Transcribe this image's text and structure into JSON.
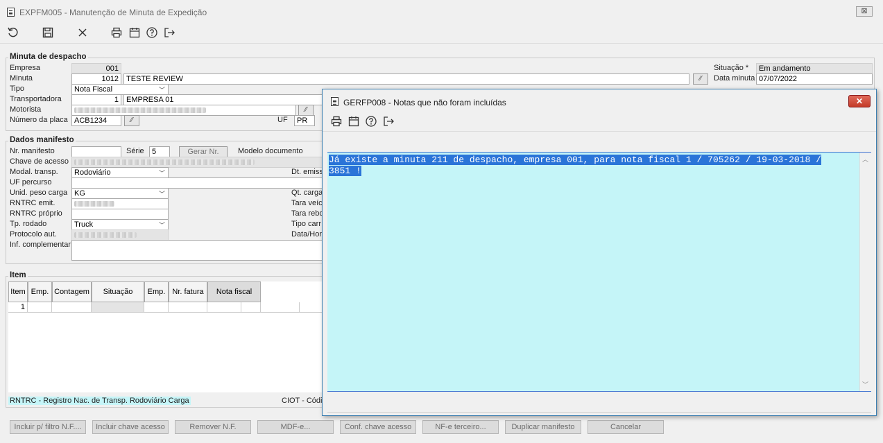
{
  "window": {
    "title": "EXPFM005 - Manutenção de Minuta de Expedição",
    "close_label": "⊠"
  },
  "toolbar_icons": [
    "refresh-icon",
    "save-icon",
    "close-icon",
    "printer-icon",
    "calendar-icon",
    "help-icon",
    "exit-icon"
  ],
  "minuta": {
    "legend": "Minuta de despacho",
    "empresa_label": "Empresa",
    "empresa_value": "001",
    "minuta_label": "Minuta",
    "minuta_value": "1012",
    "minuta_desc": "TESTE REVIEW",
    "tipo_label": "Tipo",
    "tipo_value": "Nota Fiscal",
    "transportadora_label": "Transportadora",
    "transportadora_code": "1",
    "transportadora_name": "EMPRESA 01",
    "motorista_label": "Motorista",
    "placa_label": "Número da placa",
    "placa_value": "ACB1234",
    "uf_label": "UF",
    "uf_value": "PR",
    "situacao_label": "Situação *",
    "situacao_value": "Em andamento",
    "data_label": "Data minuta",
    "data_value": "07/07/2022"
  },
  "manifesto": {
    "legend": "Dados manifesto",
    "nr_label": "Nr. manifesto",
    "serie_label": "Série",
    "serie_value": "5",
    "gerar_label": "Gerar Nr.",
    "modelo_label": "Modelo documento",
    "chave_label": "Chave de acesso",
    "modal_label": "Modal. transp.",
    "modal_value": "Rodoviário",
    "dt_emiss_label": "Dt. emiss",
    "uf_percurso_label": "UF percurso",
    "unid_label": "Unid. peso carga",
    "unid_value": "KG",
    "qt_carga_label": "Qt. carga",
    "rntrc_emit_label": "RNTRC emit.",
    "tara_veic_label": "Tara veíc",
    "rntrc_proprio_label": "RNTRC próprio",
    "tara_rebo_label": "Tara rebo",
    "rodado_label": "Tp. rodado",
    "rodado_value": "Truck",
    "tipo_carr_label": "Tipo carr",
    "protocolo_label": "Protocolo aut.",
    "data_hora_label": "Data/Hora",
    "inf_label": "Inf. complementar"
  },
  "item": {
    "legend": "Item",
    "headers": [
      "Item",
      "Emp.",
      "Contagem",
      "Situação",
      "Emp.",
      "Nr. fatura",
      "Nota fiscal"
    ],
    "row_item": "1",
    "footer_left": "RNTRC - Registro Nac. de Transp. Rodoviário Carga",
    "footer_right": "CIOT - Códig"
  },
  "buttons": [
    "Incluir p/ filtro N.F....",
    "Incluir chave acesso",
    "Remover N.F.",
    "MDF-e...",
    "Conf. chave acesso",
    "NF-e terceiro...",
    "Duplicar manifesto",
    "Cancelar"
  ],
  "dialog": {
    "title": "GERFP008 - Notas que não foram incluídas",
    "close_label": "✕",
    "message_line1": "Já existe a minuta 211 de despacho, empresa 001, para nota fiscal 1 / 705262 / 19-03-2018 /",
    "message_line2": "3851 !"
  },
  "colors": {
    "highlight": "#2a74d8",
    "message_bg": "#c5f5f8",
    "close_red": "#c43a28"
  }
}
